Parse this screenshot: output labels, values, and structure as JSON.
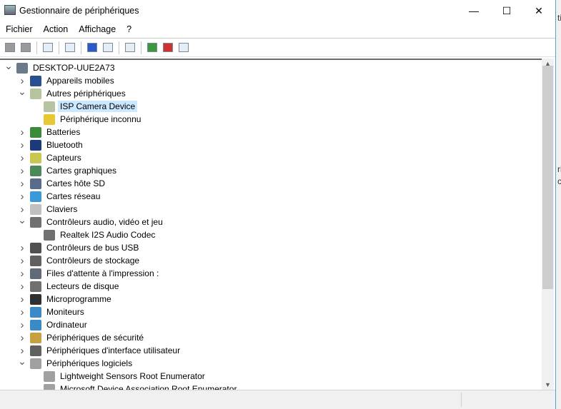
{
  "window": {
    "title": "Gestionnaire de périphériques",
    "minimize": "—",
    "maximize": "☐",
    "close": "✕"
  },
  "menu": [
    "Fichier",
    "Action",
    "Affichage",
    "?"
  ],
  "toolbar": [
    "back-icon",
    "forward-icon",
    "|",
    "show-hide-console-tree-icon",
    "|",
    "properties-icon",
    "|",
    "help-icon",
    "action-pane-icon",
    "|",
    "scan-hardware-icon",
    "|",
    "update-driver-icon",
    "uninstall-device-icon",
    "disable-device-icon"
  ],
  "tree": [
    {
      "level": 0,
      "exp": "open",
      "icon": "computer-icon",
      "color": "#6b7a8a",
      "label": "DESKTOP-UUE2A73"
    },
    {
      "level": 1,
      "exp": "closed",
      "icon": "mobile-devices-icon",
      "color": "#2a4f8f",
      "label": "Appareils mobiles"
    },
    {
      "level": 1,
      "exp": "open",
      "icon": "unknown-devices-icon",
      "color": "#b7c4a0",
      "label": "Autres périphériques"
    },
    {
      "level": 2,
      "exp": "none",
      "icon": "unknown-device-icon",
      "color": "#b7c4a0",
      "label": "ISP Camera Device",
      "selected": true
    },
    {
      "level": 2,
      "exp": "none",
      "icon": "warning-device-icon",
      "color": "#e8c832",
      "label": "Périphérique inconnu"
    },
    {
      "level": 1,
      "exp": "closed",
      "icon": "battery-icon",
      "color": "#3a8a3a",
      "label": "Batteries"
    },
    {
      "level": 1,
      "exp": "closed",
      "icon": "bluetooth-icon",
      "color": "#1a3a7a",
      "label": "Bluetooth"
    },
    {
      "level": 1,
      "exp": "closed",
      "icon": "sensor-icon",
      "color": "#c8c850",
      "label": "Capteurs"
    },
    {
      "level": 1,
      "exp": "closed",
      "icon": "display-adapter-icon",
      "color": "#4a8a5a",
      "label": "Cartes graphiques"
    },
    {
      "level": 1,
      "exp": "closed",
      "icon": "sd-host-icon",
      "color": "#5a6a8a",
      "label": "Cartes hôte SD"
    },
    {
      "level": 1,
      "exp": "closed",
      "icon": "network-adapter-icon",
      "color": "#3a9ad8",
      "label": "Cartes réseau"
    },
    {
      "level": 1,
      "exp": "closed",
      "icon": "keyboard-icon",
      "color": "#c0c0c0",
      "label": "Claviers"
    },
    {
      "level": 1,
      "exp": "open",
      "icon": "speaker-icon",
      "color": "#707070",
      "label": "Contrôleurs audio, vidéo et jeu"
    },
    {
      "level": 2,
      "exp": "none",
      "icon": "speaker-icon",
      "color": "#707070",
      "label": "Realtek I2S Audio Codec"
    },
    {
      "level": 1,
      "exp": "closed",
      "icon": "usb-icon",
      "color": "#505050",
      "label": "Contrôleurs de bus USB"
    },
    {
      "level": 1,
      "exp": "closed",
      "icon": "storage-controller-icon",
      "color": "#606060",
      "label": "Contrôleurs de stockage"
    },
    {
      "level": 1,
      "exp": "closed",
      "icon": "printer-icon",
      "color": "#606a78",
      "label": "Files d'attente à l'impression :"
    },
    {
      "level": 1,
      "exp": "closed",
      "icon": "disk-drive-icon",
      "color": "#707070",
      "label": "Lecteurs de disque"
    },
    {
      "level": 1,
      "exp": "closed",
      "icon": "firmware-icon",
      "color": "#303030",
      "label": "Microprogramme"
    },
    {
      "level": 1,
      "exp": "closed",
      "icon": "monitor-icon",
      "color": "#3a8ac8",
      "label": "Moniteurs"
    },
    {
      "level": 1,
      "exp": "closed",
      "icon": "computer-icon",
      "color": "#3a8ac8",
      "label": "Ordinateur"
    },
    {
      "level": 1,
      "exp": "closed",
      "icon": "security-devices-icon",
      "color": "#c8a040",
      "label": "Périphériques de sécurité"
    },
    {
      "level": 1,
      "exp": "closed",
      "icon": "hid-icon",
      "color": "#606060",
      "label": "Périphériques d'interface utilisateur"
    },
    {
      "level": 1,
      "exp": "open",
      "icon": "software-devices-icon",
      "color": "#a0a0a0",
      "label": "Périphériques logiciels"
    },
    {
      "level": 2,
      "exp": "none",
      "icon": "software-device-icon",
      "color": "#a0a0a0",
      "label": "Lightweight Sensors Root Enumerator"
    },
    {
      "level": 2,
      "exp": "none",
      "icon": "software-device-icon",
      "color": "#a0a0a0",
      "label": "Microsoft Device Association Root Enumerator"
    }
  ],
  "outside": {
    "text1": "ti",
    "text2": "ri",
    "text3": "c"
  }
}
